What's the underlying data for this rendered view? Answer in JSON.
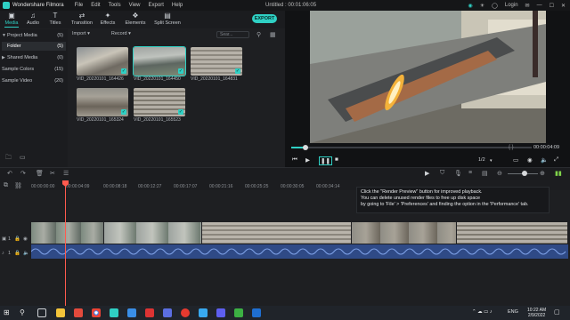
{
  "titlebar": {
    "app_name": "Wondershare Filmora",
    "menu": [
      "File",
      "Edit",
      "Tools",
      "View",
      "Export",
      "Help"
    ],
    "document": "Untitled : 00:01:06:05",
    "login": "Login"
  },
  "toolbar": {
    "tabs": [
      "Media",
      "Audio",
      "Titles",
      "Transition",
      "Effects",
      "Elements",
      "Split Screen"
    ],
    "active_tab": "Media",
    "export_label": "EXPORT"
  },
  "sidebar": {
    "items": [
      {
        "label": "Project Media",
        "count": "(5)"
      },
      {
        "label": "Folder",
        "count": "(5)"
      },
      {
        "label": "Shared Media",
        "count": "(0)"
      },
      {
        "label": "Sample Colors",
        "count": "(15)"
      },
      {
        "label": "Sample Video",
        "count": "(20)"
      }
    ]
  },
  "media": {
    "import_label": "Import",
    "record_label": "Record",
    "search_placeholder": "Sear...",
    "clips": [
      {
        "name": "VID_20220101_164426"
      },
      {
        "name": "VID_20220101_164450"
      },
      {
        "name": "VID_20220101_164831"
      },
      {
        "name": "VID_20220101_165324"
      },
      {
        "name": "VID_20220101_165523"
      }
    ]
  },
  "preview": {
    "time": "00:00:04:09",
    "progress_fraction": 0.06,
    "ratio": "1/2"
  },
  "timeline": {
    "ruler_ticks": [
      "00:00:00:00",
      "00:00:04:09",
      "00:00:08:18",
      "00:00:12:27",
      "00:00:17:07",
      "00:00:21:16",
      "00:00:25:25",
      "00:00:30:05",
      "00:00:34:14",
      "00:00:38:23"
    ],
    "tooltip_lines": [
      "Click the \"Render Preview\" button for improved playback.",
      "You can delete unused render files to free up disk space",
      "by going to 'File' > 'Preferences' and finding the option in the 'Performance' tab."
    ],
    "track_labels": [
      "1",
      "1"
    ]
  },
  "taskbar": {
    "time": "10:22 AM",
    "date": "2/9/2022",
    "lang": "ENG"
  }
}
